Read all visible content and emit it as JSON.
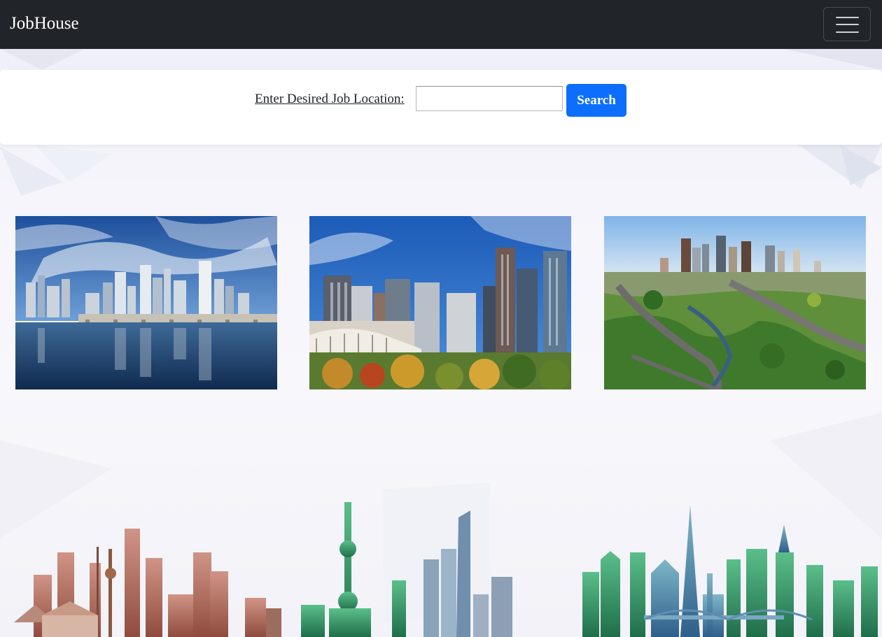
{
  "navbar": {
    "brand": "JobHouse",
    "toggler_icon": "hamburger-menu-icon",
    "background": "#212529"
  },
  "search": {
    "label": "Enter Desired Job Location:",
    "input_value": "",
    "input_placeholder": "",
    "button_label": "Search",
    "button_color": "#0d6efd"
  },
  "cities": [
    {
      "name": "city-photo-waterfront-skyline"
    },
    {
      "name": "city-photo-downtown-skyline"
    },
    {
      "name": "city-photo-aerial-skyline"
    }
  ]
}
